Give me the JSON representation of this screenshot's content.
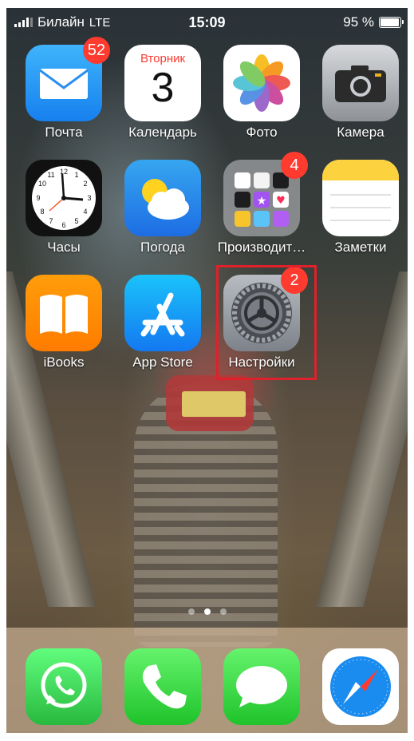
{
  "status_bar": {
    "carrier": "Билайн",
    "network": "LTE",
    "time": "15:09",
    "battery": "95 %",
    "battery_level_percent": 95
  },
  "home_apps": [
    {
      "label": "Почта",
      "icon": "mail-icon",
      "badge": "52"
    },
    {
      "label": "Календарь",
      "icon": "calendar-icon",
      "calendar_day": "Вторник",
      "calendar_date": "3"
    },
    {
      "label": "Фото",
      "icon": "photos-icon"
    },
    {
      "label": "Камера",
      "icon": "camera-icon"
    },
    {
      "label": "Часы",
      "icon": "clock-icon"
    },
    {
      "label": "Погода",
      "icon": "weather-icon"
    },
    {
      "label": "Производит…",
      "icon": "productivity-folder-icon",
      "badge": "4"
    },
    {
      "label": "Заметки",
      "icon": "notes-icon"
    },
    {
      "label": "iBooks",
      "icon": "ibooks-icon"
    },
    {
      "label": "App Store",
      "icon": "app-store-icon"
    },
    {
      "label": "Настройки",
      "icon": "settings-icon",
      "badge": "2",
      "highlighted": true
    }
  ],
  "page_dots": {
    "count": 3,
    "active_index": 1
  },
  "dock": [
    {
      "icon": "whatsapp-icon"
    },
    {
      "icon": "phone-icon"
    },
    {
      "icon": "messages-icon"
    },
    {
      "icon": "safari-icon"
    }
  ],
  "colors": {
    "badge": "#ff3b30",
    "highlight": "#e0202a"
  }
}
